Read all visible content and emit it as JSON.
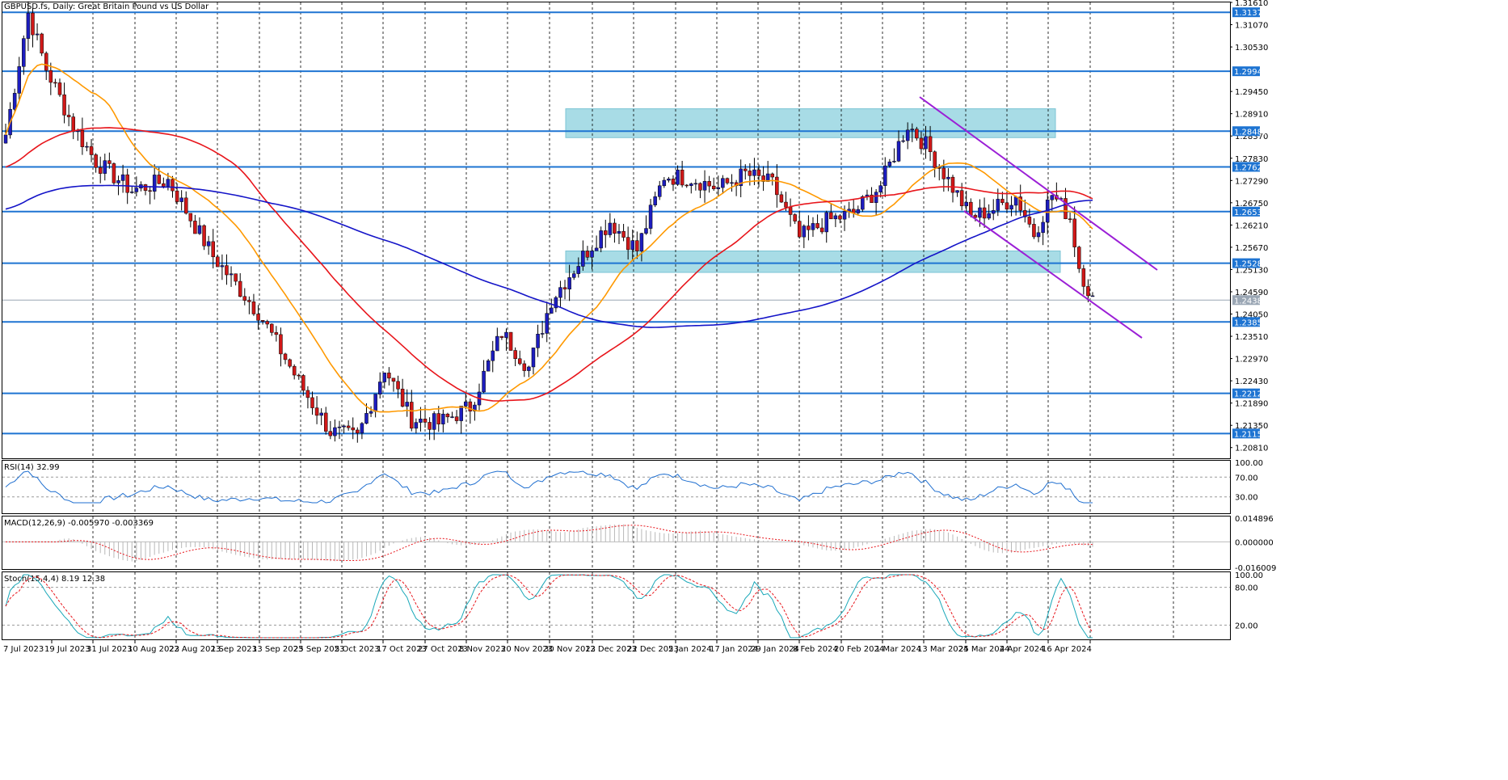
{
  "window": {
    "symbol_header": "GBPUSD.fs, Daily:  Great Britain Pound vs US Dollar",
    "background": "#ffffff",
    "bull_color": "#1d1dbf",
    "bear_color": "#d01818",
    "level_color": "#1e74d2",
    "zone_color": "#a8dce6"
  },
  "price_axis": {
    "labels": [
      "1.31610",
      "1.31070",
      "1.30530",
      "1.29450",
      "1.28910",
      "1.28370",
      "1.27830",
      "1.27290",
      "1.26750",
      "1.26210",
      "1.25670",
      "1.25130",
      "1.24590",
      "1.24050",
      "1.23510",
      "1.22970",
      "1.22430",
      "1.21890",
      "1.21350",
      "1.20810"
    ],
    "min": 1.2055,
    "max": 1.3161,
    "level_tags": [
      "1.31371",
      "1.29940",
      "1.28487",
      "1.27620",
      "1.26535",
      "1.25284",
      "1.24388",
      "1.23858",
      "1.22125",
      "1.21151"
    ]
  },
  "levels": [
    1.31371,
    1.2994,
    1.28487,
    1.2762,
    1.26535,
    1.25284,
    1.23858,
    1.22125,
    1.21151
  ],
  "current_price": 1.24388,
  "zones": [
    {
      "from": 1.2833,
      "to": 1.2903
    },
    {
      "from": 1.2506,
      "to": 1.2558
    }
  ],
  "date_axis": {
    "labels": [
      "7 Jul 2023",
      "19 Jul 2023",
      "31 Jul 2023",
      "10 Aug 2023",
      "22 Aug 2023",
      "1 Sep 2023",
      "13 Sep 2023",
      "25 Sep 2023",
      "5 Oct 2023",
      "17 Oct 2023",
      "27 Oct 2023",
      "8 Nov 2023",
      "20 Nov 2023",
      "30 Nov 2023",
      "12 Dec 2023",
      "22 Dec 2023",
      "5 Jan 2024",
      "17 Jan 2024",
      "29 Jan 2024",
      "8 Feb 2024",
      "20 Feb 2024",
      "1 Mar 2024",
      "13 Mar 2024",
      "25 Mar 2024",
      "4 Apr 2024",
      "16 Apr 2024"
    ]
  },
  "indicators": {
    "rsi": {
      "label": "RSI(14) 32.99",
      "levels": [
        "100.00",
        "70.00",
        "30.00",
        "0.00"
      ],
      "value": 32.99
    },
    "macd": {
      "label": "MACD(12,26,9) -0.005970 -0.003369",
      "levels": [
        "0.014896",
        "0.000000",
        "-0.016009"
      ],
      "main": -0.00597,
      "signal": -0.003369
    },
    "stoch": {
      "label": "Stoch(15,4,4) 8.19 12.38",
      "levels": [
        "100.00",
        "80.00",
        "20.00",
        "0.00"
      ],
      "k": 8.19,
      "d": 12.38
    }
  },
  "chart_data": {
    "type": "candlestick",
    "symbol": "GBPUSD.fs",
    "timeframe": "Daily",
    "ylim": [
      1.2055,
      1.3161
    ],
    "key_closes": [
      {
        "date": "7 Jul 2023",
        "close": 1.284
      },
      {
        "date": "13 Jul 2023",
        "close": 1.313
      },
      {
        "date": "22 Aug 2023",
        "close": 1.273
      },
      {
        "date": "25 Sep 2023",
        "close": 1.218
      },
      {
        "date": "5 Oct 2023",
        "close": 1.2105
      },
      {
        "date": "8 Nov 2023",
        "close": 1.2275
      },
      {
        "date": "30 Nov 2023",
        "close": 1.2625
      },
      {
        "date": "28 Dec 2023",
        "close": 1.2735
      },
      {
        "date": "8 Mar 2024",
        "close": 1.2865
      },
      {
        "date": "4 Apr 2024",
        "close": 1.2695
      },
      {
        "date": "16 Apr 2024",
        "close": 1.2439
      }
    ]
  }
}
